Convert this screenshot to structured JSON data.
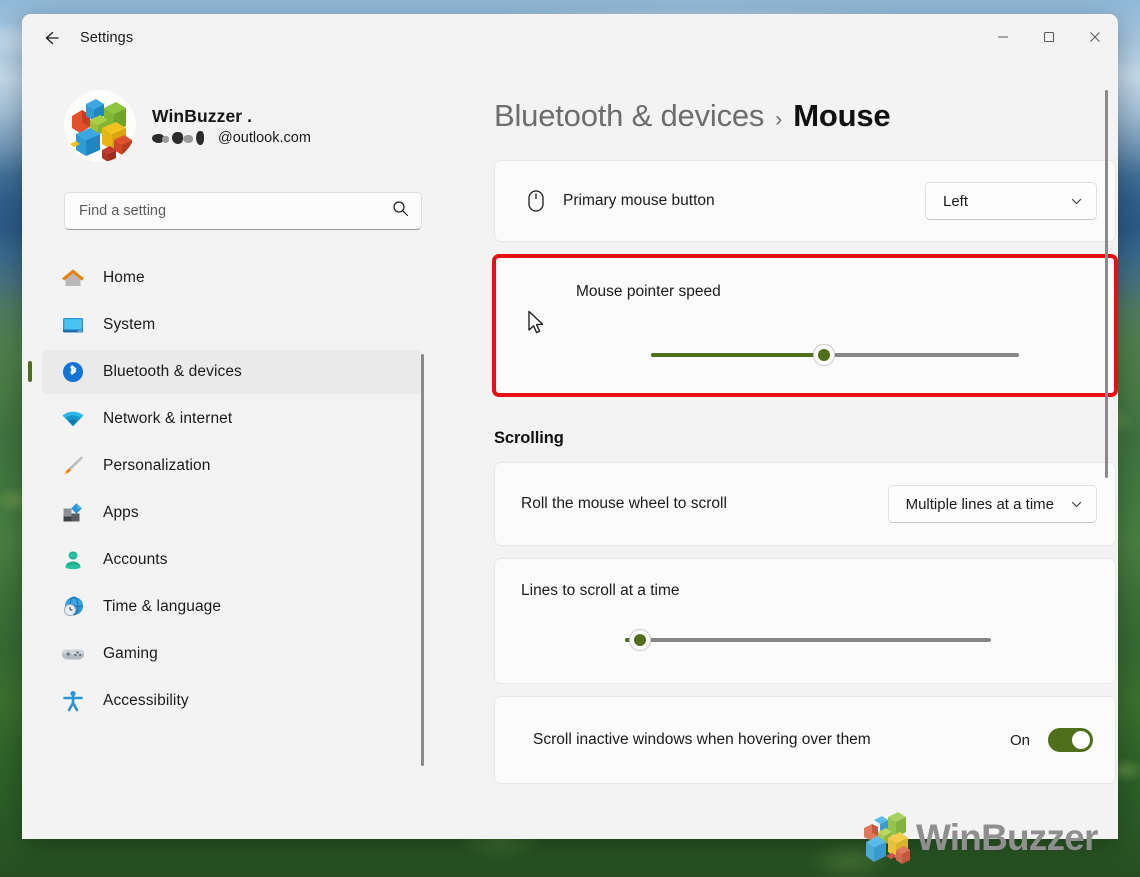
{
  "window": {
    "app_title": "Settings",
    "back_icon": "back-arrow-icon",
    "controls": {
      "minimize": "minimize-icon",
      "maximize": "maximize-icon",
      "close": "close-icon"
    }
  },
  "profile": {
    "name": "WinBuzzer .",
    "email": "@outlook.com",
    "avatar": "cubes-avatar"
  },
  "search": {
    "placeholder": "Find a setting",
    "value": "",
    "icon": "search-icon"
  },
  "sidebar": {
    "items": [
      {
        "label": "Home",
        "icon": "home-icon",
        "selected": false
      },
      {
        "label": "System",
        "icon": "monitor-icon",
        "selected": false
      },
      {
        "label": "Bluetooth & devices",
        "icon": "bluetooth-icon",
        "selected": true
      },
      {
        "label": "Network & internet",
        "icon": "wifi-icon",
        "selected": false
      },
      {
        "label": "Personalization",
        "icon": "paintbrush-icon",
        "selected": false
      },
      {
        "label": "Apps",
        "icon": "apps-icon",
        "selected": false
      },
      {
        "label": "Accounts",
        "icon": "person-icon",
        "selected": false
      },
      {
        "label": "Time & language",
        "icon": "clock-globe-icon",
        "selected": false
      },
      {
        "label": "Gaming",
        "icon": "gamepad-icon",
        "selected": false
      },
      {
        "label": "Accessibility",
        "icon": "accessibility-icon",
        "selected": false
      }
    ]
  },
  "breadcrumb": {
    "parent": "Bluetooth & devices",
    "separator": "›",
    "current": "Mouse"
  },
  "main": {
    "primary_mouse_button": {
      "label": "Primary mouse button",
      "icon": "mouse-icon",
      "value": "Left",
      "chevron": "chevron-down-icon"
    },
    "pointer_speed": {
      "label": "Mouse pointer speed",
      "slider_percent": 47,
      "highlighted": true,
      "highlight_color": "#e81014",
      "cursor_icon": "arrow-cursor-icon"
    },
    "scrolling_section": {
      "heading": "Scrolling",
      "wheel_scroll": {
        "label": "Roll the mouse wheel to scroll",
        "value": "Multiple lines at a time",
        "chevron": "chevron-down-icon"
      },
      "lines_to_scroll": {
        "label": "Lines to scroll at a time",
        "slider_percent": 4
      },
      "inactive_scroll": {
        "label": "Scroll inactive windows when hovering over them",
        "state_label": "On",
        "enabled": true
      }
    }
  },
  "theme": {
    "accent": "#4f6f1d",
    "slider_track": "#868686",
    "card_background": "#fbfbfb",
    "window_background": "#f3f3f3",
    "highlight": "#e81014"
  },
  "watermark": {
    "text": "WinBuzzer",
    "logo": "winbuzzer-cubes-logo"
  }
}
